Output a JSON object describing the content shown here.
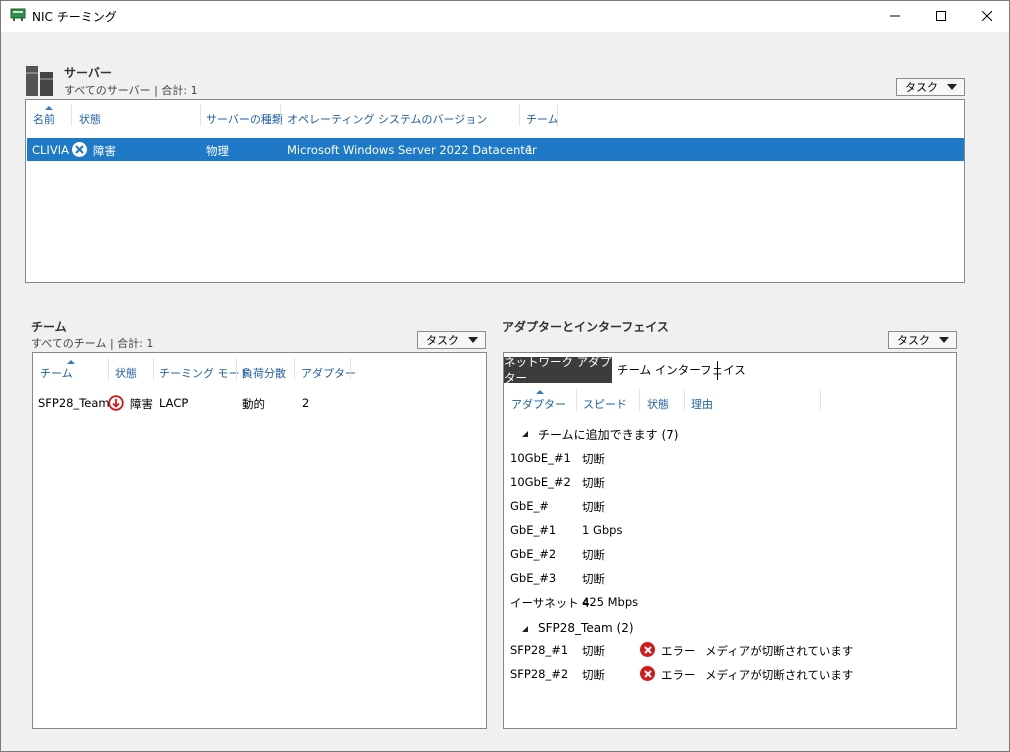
{
  "window": {
    "title": "NIC チーミング"
  },
  "servers": {
    "title": "サーバー",
    "subtitle": "すべてのサーバー | 合計: 1",
    "task_label": "タスク",
    "columns": [
      "名前",
      "状態",
      "サーバーの種類",
      "オペレーティング システムのバージョン",
      "チーム"
    ],
    "rows": [
      {
        "name": "CLIVIA",
        "status": "障害",
        "type": "物理",
        "os": "Microsoft Windows Server 2022 Datacenter",
        "teams": "1"
      }
    ]
  },
  "teams": {
    "title": "チーム",
    "subtitle": "すべてのチーム | 合計: 1",
    "task_label": "タスク",
    "columns": [
      "チーム",
      "状態",
      "チーミング モード",
      "負荷分散",
      "アダプター"
    ],
    "rows": [
      {
        "team": "SFP28_Team",
        "status": "障害",
        "mode": "LACP",
        "lb": "動的",
        "adapters": "2"
      }
    ]
  },
  "adapters": {
    "title": "アダプターとインターフェイス",
    "task_label": "タスク",
    "tabs": [
      "ネットワーク アダプター",
      "チーム インターフェイス"
    ],
    "columns": [
      "アダプター",
      "スピード",
      "状態",
      "理由"
    ],
    "group1": {
      "label": "チームに追加できます (7)",
      "rows": [
        {
          "name": "10GbE_#1",
          "speed": "切断"
        },
        {
          "name": "10GbE_#2",
          "speed": "切断"
        },
        {
          "name": "GbE_#",
          "speed": "切断"
        },
        {
          "name": "GbE_#1",
          "speed": "1 Gbps"
        },
        {
          "name": "GbE_#2",
          "speed": "切断"
        },
        {
          "name": "GbE_#3",
          "speed": "切断"
        },
        {
          "name": "イーサネット 4",
          "speed": "425 Mbps"
        }
      ]
    },
    "group2": {
      "label": "SFP28_Team (2)",
      "rows": [
        {
          "name": "SFP28_#1",
          "speed": "切断",
          "status": "エラー",
          "reason": "メディアが切断されています"
        },
        {
          "name": "SFP28_#2",
          "speed": "切断",
          "status": "エラー",
          "reason": "メディアが切断されています"
        }
      ]
    }
  },
  "colors": {
    "selection": "#1e79c6",
    "header_text": "#1f5fa8",
    "error": "#d21a1a"
  }
}
